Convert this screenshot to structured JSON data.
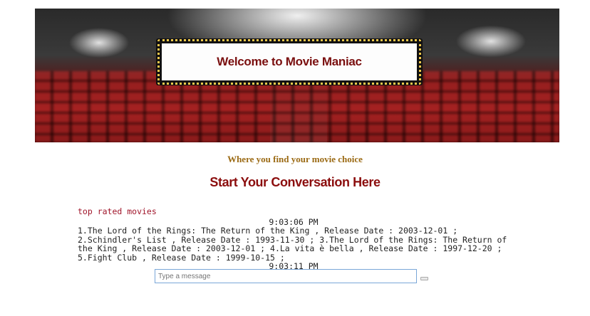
{
  "header": {
    "marquee_title": "Welcome to Movie Maniac"
  },
  "tagline": "Where you find your movie choice",
  "cta": "Start Your Conversation Here",
  "chat": {
    "messages": [
      {
        "role": "user",
        "text": "top rated movies"
      },
      {
        "role": "time",
        "text": "9:03:06 PM"
      },
      {
        "role": "bot",
        "text": "1.The Lord of the Rings: The Return of the King , Release Date : 2003-12-01 ; 2.Schindler's List , Release Date : 1993-11-30 ; 3.The Lord of the Rings: The Return of the King , Release Date : 2003-12-01 ; 4.La vita è bella , Release Date : 1997-12-20 ; 5.Fight Club , Release Date : 1999-10-15 ;"
      },
      {
        "role": "time",
        "text": "9:03:11 PM"
      }
    ]
  },
  "composer": {
    "placeholder": "Type a message"
  }
}
